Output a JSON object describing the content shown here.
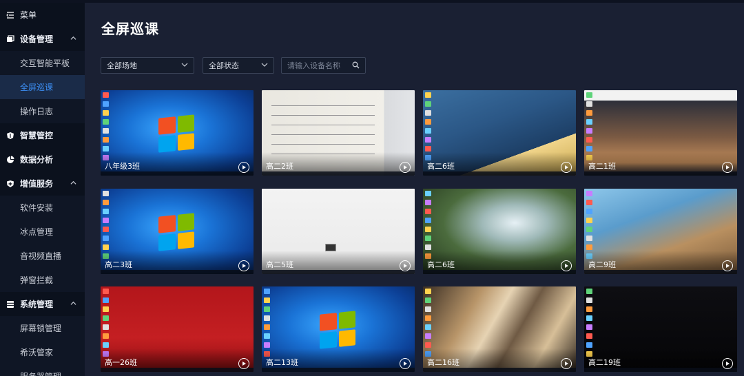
{
  "sidebar": {
    "items": [
      {
        "label": "菜单",
        "icon": "menu-fold-icon",
        "type": "header"
      },
      {
        "label": "设备管理",
        "icon": "device-icon",
        "type": "group",
        "expanded": true
      },
      {
        "label": "交互智能平板",
        "type": "sub"
      },
      {
        "label": "全屏巡课",
        "type": "sub",
        "active": true
      },
      {
        "label": "操作日志",
        "type": "sub"
      },
      {
        "label": "智慧管控",
        "icon": "shield-control-icon",
        "type": "group"
      },
      {
        "label": "数据分析",
        "icon": "pie-chart-icon",
        "type": "group"
      },
      {
        "label": "增值服务",
        "icon": "plus-shield-icon",
        "type": "group",
        "expanded": true
      },
      {
        "label": "软件安装",
        "type": "sub"
      },
      {
        "label": "冰点管理",
        "type": "sub"
      },
      {
        "label": "音视频直播",
        "type": "sub"
      },
      {
        "label": "弹窗拦截",
        "type": "sub"
      },
      {
        "label": "系统管理",
        "icon": "system-icon",
        "type": "group",
        "expanded": true
      },
      {
        "label": "屏幕锁管理",
        "type": "sub"
      },
      {
        "label": "希沃管家",
        "type": "sub"
      },
      {
        "label": "服务器管理",
        "type": "sub"
      }
    ]
  },
  "main": {
    "title": "全屏巡课",
    "filters": {
      "location": "全部场地",
      "status": "全部状态",
      "search_placeholder": "请输入设备名称"
    },
    "tiles": [
      {
        "label": "八年级3班",
        "theme": "win7"
      },
      {
        "label": "高二2班",
        "theme": "paper"
      },
      {
        "label": "高二6班",
        "theme": "track"
      },
      {
        "label": "高二1班",
        "theme": "basketball"
      },
      {
        "label": "高二3班",
        "theme": "win7"
      },
      {
        "label": "高二5班",
        "theme": "white"
      },
      {
        "label": "高二6班",
        "theme": "waterfall"
      },
      {
        "label": "高二9班",
        "theme": "room"
      },
      {
        "label": "高一26班",
        "theme": "red"
      },
      {
        "label": "高二13班",
        "theme": "win7"
      },
      {
        "label": "高二16班",
        "theme": "abstract"
      },
      {
        "label": "高二19班",
        "theme": "dark"
      }
    ]
  },
  "colors": {
    "sidebar_bg": "#0b111d",
    "main_bg": "#1a2033",
    "active_text": "#3c8ff5",
    "active_bg": "#1a2b48"
  }
}
